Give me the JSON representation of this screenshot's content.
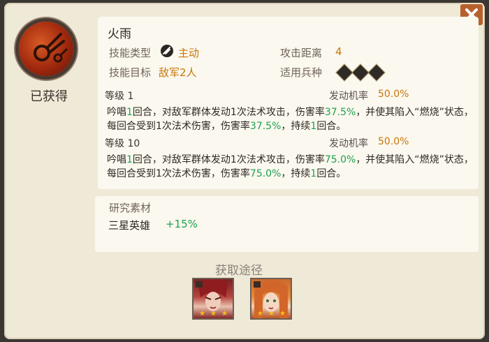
{
  "skill": {
    "name": "火雨",
    "status": "已获得",
    "type_label": "技能类型",
    "type_value": "主动",
    "range_label": "攻击距离",
    "range_value": "4",
    "target_label": "技能目标",
    "target_value": "敌军2人",
    "troops_label": "适用兵种",
    "troop_icons": [
      "spear-troop-icon",
      "shield-troop-icon",
      "bow-troop-icon"
    ]
  },
  "levels": [
    {
      "level_text": "等级 1",
      "rate_label": "发动机率",
      "rate_value": "50.0%",
      "desc": {
        "p1": "吟唱",
        "n1": "1",
        "p2": "回合，对敌军群体发动1次法术攻击，伤害率",
        "n2": "37.5%",
        "p3": "，并使其陷入“燃烧”状态，每回合受到1次法术伤害，伤害率",
        "n3": "37.5%",
        "p4": "，持续",
        "n4": "1",
        "p5": "回合。"
      }
    },
    {
      "level_text": "等级 10",
      "rate_label": "发动机率",
      "rate_value": "50.0%",
      "desc": {
        "p1": "吟唱",
        "n1": "1",
        "p2": "回合，对敌军群体发动1次法术攻击，伤害率",
        "n2": "75.0%",
        "p3": "，并使其陷入“燃烧”状态，每回合受到1次法术伤害，伤害率",
        "n3": "75.0%",
        "p4": "，持续",
        "n4": "1",
        "p5": "回合。"
      }
    }
  ],
  "research": {
    "title": "研究素材",
    "item_name": "三星英雄",
    "item_bonus": "+15%"
  },
  "acquire": {
    "title": "获取途径",
    "heroes": [
      {
        "stars": 3,
        "name": "red-haired-hero-portrait"
      },
      {
        "stars": 3,
        "name": "orange-haired-hero-portrait"
      }
    ]
  },
  "colors": {
    "highlight_green": "#1da24d",
    "accent_orange": "#c8760a",
    "close_button": "#b5612f"
  }
}
